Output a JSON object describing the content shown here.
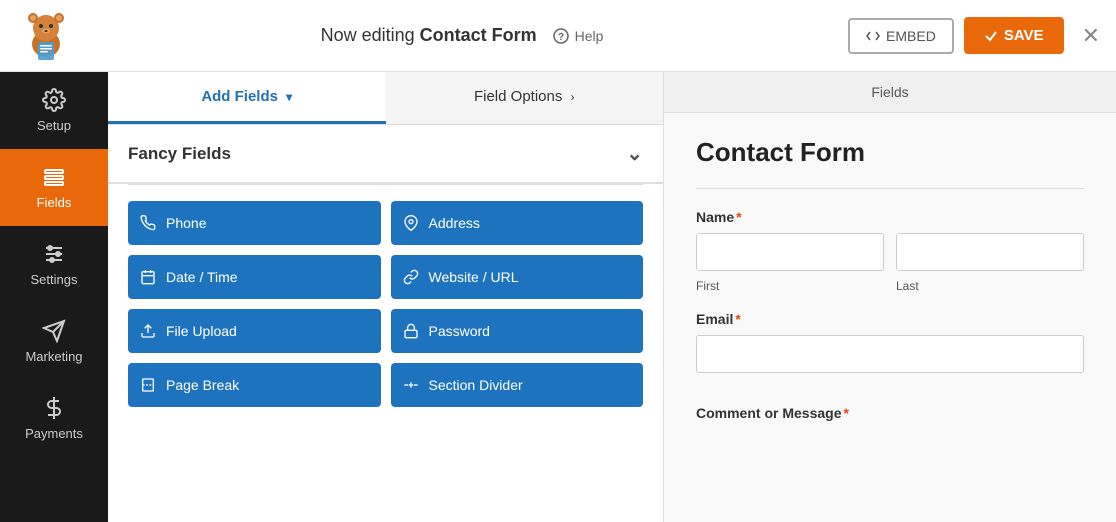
{
  "topbar": {
    "editing_prefix": "Now editing ",
    "form_name": "Contact Form",
    "help_label": "Help",
    "embed_label": "EMBED",
    "save_label": "SAVE"
  },
  "sidebar": {
    "items": [
      {
        "id": "setup",
        "label": "Setup",
        "active": false
      },
      {
        "id": "fields",
        "label": "Fields",
        "active": true
      },
      {
        "id": "settings",
        "label": "Settings",
        "active": false
      },
      {
        "id": "marketing",
        "label": "Marketing",
        "active": false
      },
      {
        "id": "payments",
        "label": "Payments",
        "active": false
      }
    ]
  },
  "fields_panel": {
    "preview_tab_label": "Fields",
    "tabs": [
      {
        "id": "add-fields",
        "label": "Add Fields",
        "active": true
      },
      {
        "id": "field-options",
        "label": "Field Options",
        "active": false
      }
    ],
    "fancy_fields_label": "Fancy Fields",
    "buttons": [
      {
        "id": "phone",
        "label": "Phone",
        "icon": "phone"
      },
      {
        "id": "address",
        "label": "Address",
        "icon": "map-pin"
      },
      {
        "id": "date-time",
        "label": "Date / Time",
        "icon": "calendar"
      },
      {
        "id": "website-url",
        "label": "Website / URL",
        "icon": "link"
      },
      {
        "id": "file-upload",
        "label": "File Upload",
        "icon": "upload"
      },
      {
        "id": "password",
        "label": "Password",
        "icon": "lock"
      },
      {
        "id": "page-break",
        "label": "Page Break",
        "icon": "page-break"
      },
      {
        "id": "section-divider",
        "label": "Section Divider",
        "icon": "section-divider"
      }
    ]
  },
  "form_preview": {
    "title": "Contact Form",
    "fields": [
      {
        "id": "name",
        "label": "Name",
        "required": true,
        "type": "name",
        "sub_labels": [
          "First",
          "Last"
        ]
      },
      {
        "id": "email",
        "label": "Email",
        "required": true,
        "type": "email"
      },
      {
        "id": "comment",
        "label": "Comment or Message",
        "required": true,
        "type": "textarea"
      }
    ]
  }
}
